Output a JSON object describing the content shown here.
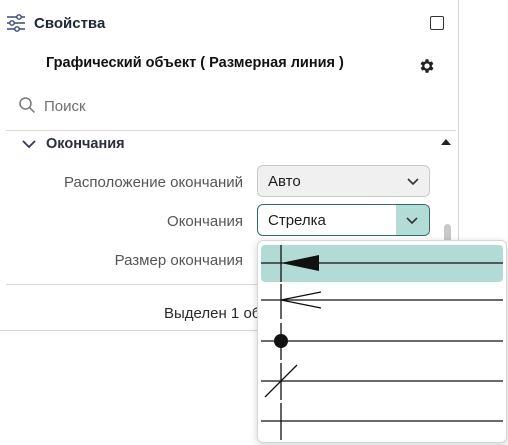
{
  "panel": {
    "title": "Свойства",
    "title_icon": "sliders-icon",
    "object_title": "Графический объект ( Размерная линия )",
    "search": {
      "placeholder": "Поиск",
      "value": ""
    }
  },
  "section": {
    "title": "Окончания",
    "expanded": true
  },
  "properties": [
    {
      "label": "Расположение окончаний",
      "value": "Авто"
    },
    {
      "label": "Окончания",
      "value": "Стрелка",
      "open": true
    },
    {
      "label": "Размер окончания",
      "value": ""
    }
  ],
  "status": {
    "text": "Выделен 1 об"
  },
  "dropdown": {
    "options": [
      {
        "name": "arrow-filled",
        "selected": true
      },
      {
        "name": "arrow-open",
        "selected": false
      },
      {
        "name": "dot",
        "selected": false
      },
      {
        "name": "slash",
        "selected": false
      },
      {
        "name": "none",
        "selected": false
      }
    ]
  },
  "colors": {
    "accent": "#2f6b64",
    "selection": "#b2dbd5"
  }
}
